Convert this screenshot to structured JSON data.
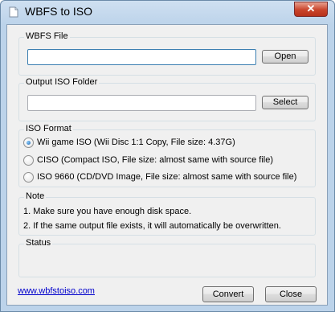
{
  "window": {
    "title": "WBFS to ISO",
    "close_glyph": "✕"
  },
  "wbfs_file": {
    "legend": "WBFS File",
    "value": "",
    "button": "Open"
  },
  "output_folder": {
    "legend": "Output ISO Folder",
    "value": "",
    "button": "Select"
  },
  "iso_format": {
    "legend": "ISO Format",
    "options": [
      {
        "label": "Wii game ISO (Wii Disc 1:1 Copy, File size: 4.37G)",
        "checked": true
      },
      {
        "label": "CISO (Compact ISO, File size: almost same with source file)",
        "checked": false
      },
      {
        "label": "ISO 9660 (CD/DVD Image, File size: almost same with source file)",
        "checked": false
      }
    ]
  },
  "note": {
    "legend": "Note",
    "lines": [
      "1. Make sure you have enough disk space.",
      "2. If the same output file exists, it will automatically be overwritten."
    ]
  },
  "status": {
    "legend": "Status",
    "text": ""
  },
  "footer": {
    "link": "www.wbfstoiso.com",
    "convert": "Convert",
    "close": "Close"
  },
  "icons": {
    "app": "document-icon",
    "close": "close-icon"
  }
}
